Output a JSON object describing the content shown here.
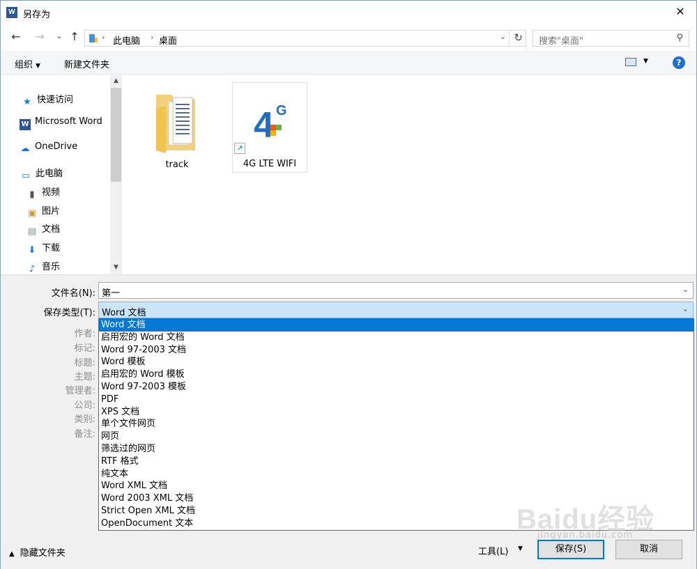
{
  "window": {
    "title": "另存为",
    "close_glyph": "✕"
  },
  "nav": {
    "breadcrumb": [
      "此电脑",
      "桌面"
    ],
    "search_placeholder": "搜索\"桌面\""
  },
  "toolbar": {
    "organize": "组织",
    "new_folder": "新建文件夹",
    "help": "?"
  },
  "sidebar": {
    "items": [
      {
        "label": "快速访问",
        "icon": "star-icon"
      },
      {
        "label": "Microsoft Word",
        "icon": "word-icon"
      },
      {
        "label": "OneDrive",
        "icon": "cloud-icon"
      },
      {
        "label": "此电脑",
        "icon": "computer-icon"
      },
      {
        "label": "视频",
        "icon": "video-folder-icon"
      },
      {
        "label": "图片",
        "icon": "picture-folder-icon"
      },
      {
        "label": "文档",
        "icon": "document-folder-icon"
      },
      {
        "label": "下载",
        "icon": "download-folder-icon"
      },
      {
        "label": "音乐",
        "icon": "music-folder-icon"
      }
    ]
  },
  "files": [
    {
      "name": "track",
      "icon": "folder-icon"
    },
    {
      "name": "4G LTE WIFI",
      "icon": "shortcut-icon"
    }
  ],
  "form": {
    "filename_label": "文件名(N):",
    "filename_value": "第一",
    "filetype_label": "保存类型(T):",
    "filetype_value": "Word 文档",
    "meta_labels": [
      "作者:",
      "标记:",
      "标题:",
      "主题:",
      "管理者:",
      "公司:",
      "类别:",
      "备注:"
    ]
  },
  "filetype_options": [
    "Word 文档",
    "启用宏的 Word 文档",
    "Word 97-2003 文档",
    "Word 模板",
    "启用宏的 Word 模板",
    "Word 97-2003 模板",
    "PDF",
    "XPS 文档",
    "单个文件网页",
    "网页",
    "筛选过的网页",
    "RTF 格式",
    "纯文本",
    "Word XML 文档",
    "Word 2003 XML 文档",
    "Strict Open XML 文档",
    "OpenDocument 文本"
  ],
  "footer": {
    "hide_folders": "隐藏文件夹",
    "tools": "工具(L)",
    "save": "保存(S)",
    "cancel": "取消"
  },
  "watermark": {
    "text": "Baidu经验",
    "sub": "jingyan.baidu.com"
  },
  "colors": {
    "selection": "#0078d7",
    "accent_blue": "#2b579a"
  }
}
